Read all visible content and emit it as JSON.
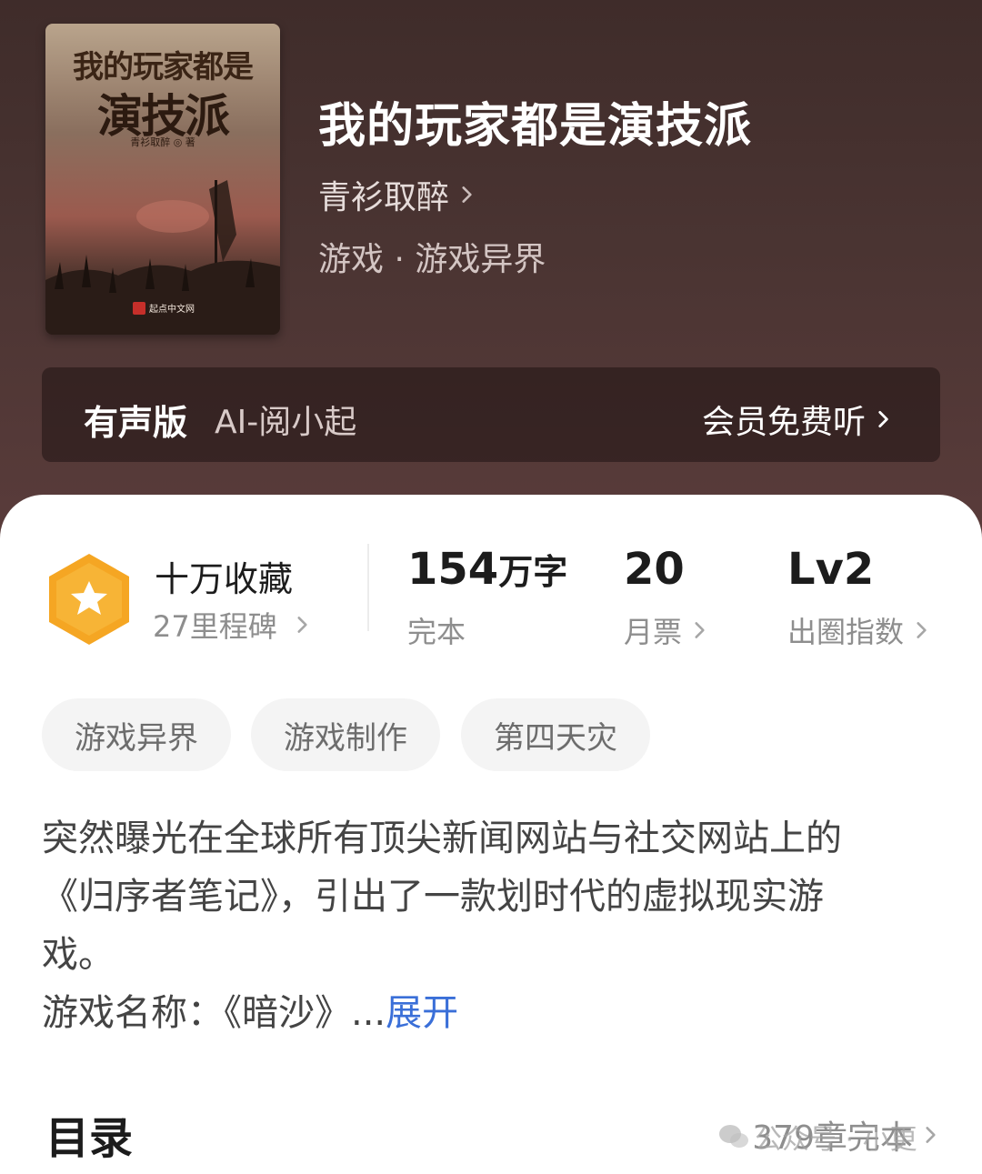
{
  "book": {
    "title": "我的玩家都是演技派",
    "author": "青衫取醉",
    "genre": "游戏 · 游戏异界",
    "cover": {
      "title_line1": "我的玩家都是",
      "title_line2": "演技派",
      "author": "青衫取醉 ◎ 著",
      "publisher": "起点中文网"
    }
  },
  "audio": {
    "label": "有声版",
    "narrator": "AI-阅小起",
    "cta": "会员免费听"
  },
  "stats": {
    "collection": {
      "main": "十万收藏",
      "sub": "27里程碑"
    },
    "words": {
      "value": "154",
      "unit": "万字",
      "status": "完本"
    },
    "monthly_votes": {
      "value": "20",
      "label": "月票"
    },
    "level": {
      "value": "Lv2",
      "label": "出圈指数"
    }
  },
  "tags": [
    "游戏异界",
    "游戏制作",
    "第四天灾"
  ],
  "description": {
    "lines": [
      "突然曝光在全球所有顶尖新闻网站与社交网站上的",
      "《归序者笔记》，引出了一款划时代的虚拟现实游",
      "戏。",
      "游戏名称：《暗沙》..."
    ],
    "expand": "展开"
  },
  "toc": {
    "title": "目录",
    "count": "379章完本"
  },
  "watermark": "公众号 · 小更",
  "colors": {
    "accent_blue": "#3a6fd8",
    "medal_orange": "#f5a623",
    "hero_bg": "#4a3432"
  }
}
